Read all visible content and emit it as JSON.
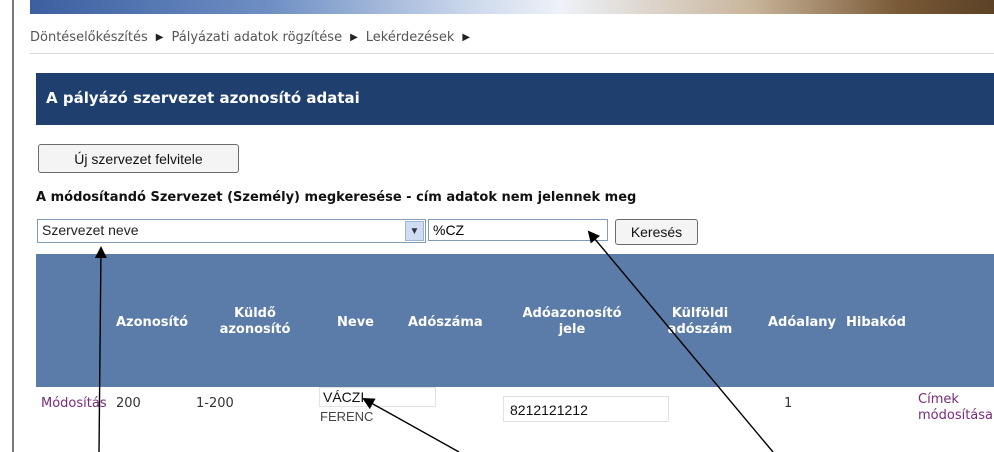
{
  "menu": [
    {
      "label": "Döntéselőkészítés"
    },
    {
      "label": "Pályázati adatok rögzítése"
    },
    {
      "label": "Lekérdezések"
    }
  ],
  "panel_title": "A pályázó szervezet azonosító adatai",
  "new_org_button": "Új szervezet felvitele",
  "search_label": "A módosítandó Szervezet (Személy) megkeresése - cím adatok nem jelennek meg",
  "search_field_select": "Szervezet neve",
  "search_input_value": "%CZ",
  "search_button": "Keresés",
  "table": {
    "headers": {
      "azonosito": "Azonosító",
      "kuldo_1": "Küldő",
      "kuldo_2": "azonosító",
      "neve": "Neve",
      "adoszama": "Adószáma",
      "adoazonosito_1": "Adóazonosító",
      "adoazonosito_2": "jele",
      "kulfoldi_1": "Külföldi",
      "kulfoldi_2": "adószám",
      "adoalany": "Adóalany",
      "hibakod": "Hibakód"
    },
    "row": {
      "modify_link": "Módosítás",
      "azonosito": "200",
      "kuldo_azonosito": "1-200",
      "name_field": "VÁCZI",
      "name_second": "FERENC",
      "adoazonosito_jele": "8212121212",
      "adoalany": "1",
      "cimek_1": "Címek",
      "cimek_2": "módosítása"
    }
  },
  "colors": {
    "title_bar": "#1f3f6f",
    "table_header": "#5b7ba8",
    "link": "#7a2a7a"
  },
  "icons": {
    "menu_separator": "triangle-right-icon",
    "dropdown": "chevron-down-icon"
  }
}
